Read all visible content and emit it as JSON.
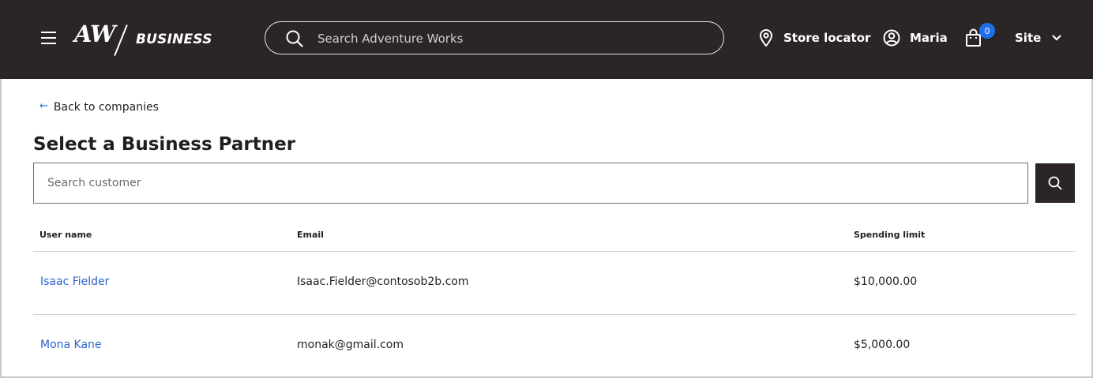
{
  "header": {
    "menu_icon": "hamburger-menu-icon",
    "logo": {
      "mark": "AW",
      "text": "BUSINESS"
    },
    "search": {
      "placeholder": "Search Adventure Works",
      "icon": "search-icon"
    },
    "store_locator": {
      "label": "Store locator",
      "icon": "location-pin-icon"
    },
    "account": {
      "label": "Maria",
      "icon": "user-icon"
    },
    "cart": {
      "count": "0",
      "icon": "shopping-bag-icon",
      "badge_color": "#1f6feb"
    },
    "site": {
      "label": "Site",
      "icon": "chevron-down-icon"
    },
    "background_color": "#2b2528"
  },
  "main": {
    "back_link": "Back to companies",
    "title": "Select a Business Partner",
    "customer_search": {
      "placeholder": "Search customer"
    },
    "table": {
      "headers": {
        "user_name": "User name",
        "email": "Email",
        "spending_limit": "Spending limit"
      },
      "rows": [
        {
          "user_name": "Isaac Fielder",
          "email": "Isaac.Fielder@contosob2b.com",
          "spending_limit": "$10,000.00"
        },
        {
          "user_name": "Mona Kane",
          "email": "monak@gmail.com",
          "spending_limit": "$5,000.00"
        }
      ]
    },
    "link_color": "#2a64c9"
  }
}
